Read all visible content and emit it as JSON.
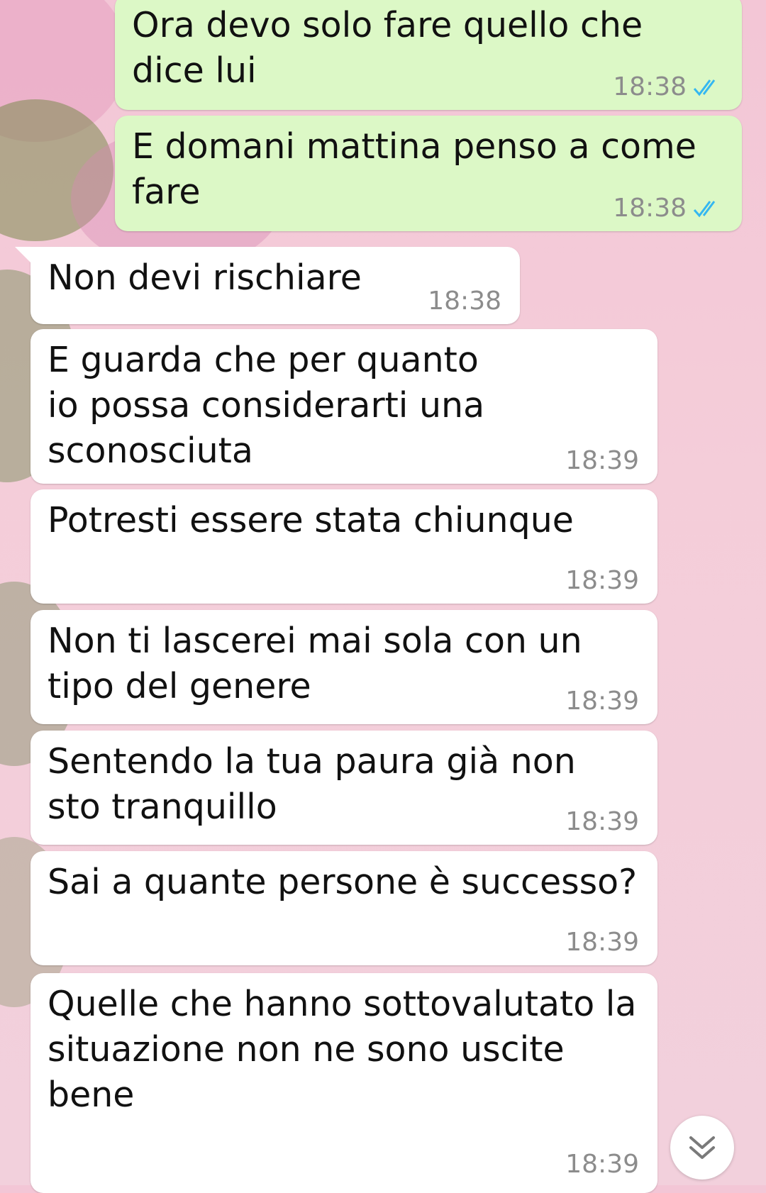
{
  "chat": {
    "messages": [
      {
        "direction": "out",
        "text": "Ora devo solo fare quello che dice lui",
        "time": "18:38",
        "status": "read-double-check-icon"
      },
      {
        "direction": "out",
        "text": "E domani mattina penso a come fare",
        "time": "18:38",
        "status": "read-double-check-icon"
      },
      {
        "direction": "in",
        "text": "Non devi rischiare",
        "time": "18:38"
      },
      {
        "direction": "in",
        "text": "E guarda che per quanto io possa considerarti una sconosciuta",
        "time": "18:39"
      },
      {
        "direction": "in",
        "text": "Potresti essere stata chiunque",
        "time": "18:39"
      },
      {
        "direction": "in",
        "text": "Non ti lascerei mai sola con un tipo del genere",
        "time": "18:39"
      },
      {
        "direction": "in",
        "text": "Sentendo la tua paura già non sto tranquillo",
        "time": "18:39"
      },
      {
        "direction": "in",
        "text": "Sai a quante persone è successo?",
        "time": "18:39"
      },
      {
        "direction": "in",
        "text": "Quelle che hanno sottovalutato la situazione non ne sono uscite bene",
        "time": "18:39"
      }
    ]
  },
  "controls": {
    "scroll_down_icon": "double-chevron-down-icon"
  },
  "colors": {
    "outgoing_bubble": "#dcf8c6",
    "incoming_bubble": "#ffffff",
    "read_tick": "#34b7f1",
    "wallpaper": "#f3c6d6"
  }
}
